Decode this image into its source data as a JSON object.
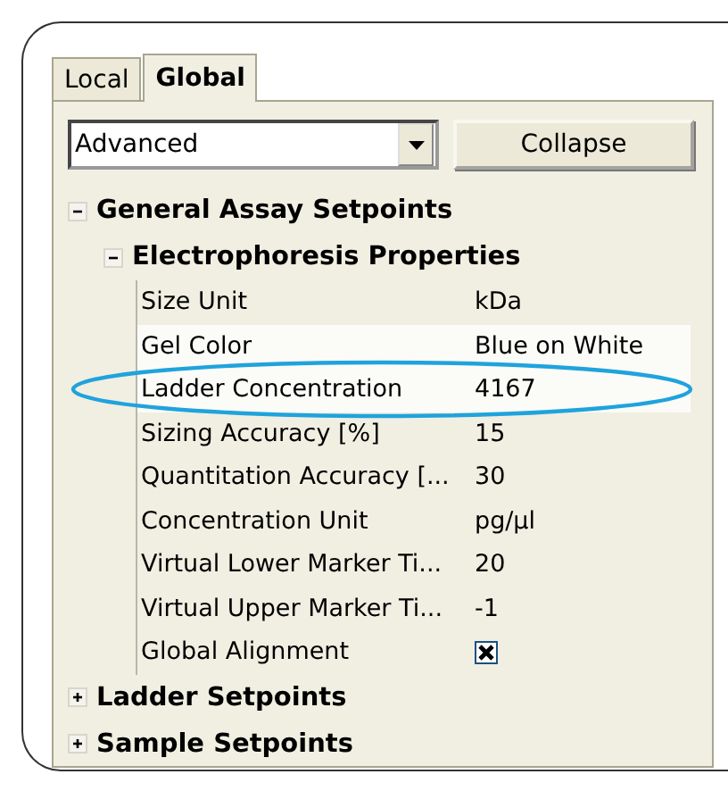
{
  "tabs": [
    {
      "label": "Local",
      "selected": false
    },
    {
      "label": "Global",
      "selected": true
    }
  ],
  "view_select": {
    "value": "Advanced"
  },
  "collapse_button": "Collapse",
  "tree": [
    {
      "label": "General Assay Setpoints",
      "expanded": true,
      "children": [
        {
          "label": "Electrophoresis Properties",
          "expanded": true,
          "properties": [
            {
              "kind": "text",
              "name": "Size Unit",
              "value": "kDa",
              "highlighted": false,
              "circled": false
            },
            {
              "kind": "text",
              "name": "Gel Color",
              "value": "Blue on White",
              "highlighted": true,
              "circled": false
            },
            {
              "kind": "text",
              "name": "Ladder Concentration",
              "value": "4167",
              "highlighted": true,
              "circled": true
            },
            {
              "kind": "text",
              "name": "Sizing Accuracy [%]",
              "value": "15",
              "highlighted": false,
              "circled": false
            },
            {
              "kind": "text",
              "name": "Quantitation Accuracy [...",
              "value": "30",
              "highlighted": false,
              "circled": false
            },
            {
              "kind": "text",
              "name": "Concentration Unit",
              "value": "pg/µl",
              "highlighted": false,
              "circled": false
            },
            {
              "kind": "text",
              "name": "Virtual Lower Marker Ti...",
              "value": "20",
              "highlighted": false,
              "circled": false
            },
            {
              "kind": "text",
              "name": "Virtual Upper Marker Ti...",
              "value": "-1",
              "highlighted": false,
              "circled": false
            },
            {
              "kind": "checkbox",
              "name": "Global Alignment",
              "checked": true,
              "highlighted": false,
              "circled": false
            }
          ]
        }
      ]
    },
    {
      "label": "Ladder Setpoints",
      "expanded": false
    },
    {
      "label": "Sample Setpoints",
      "expanded": false
    }
  ]
}
